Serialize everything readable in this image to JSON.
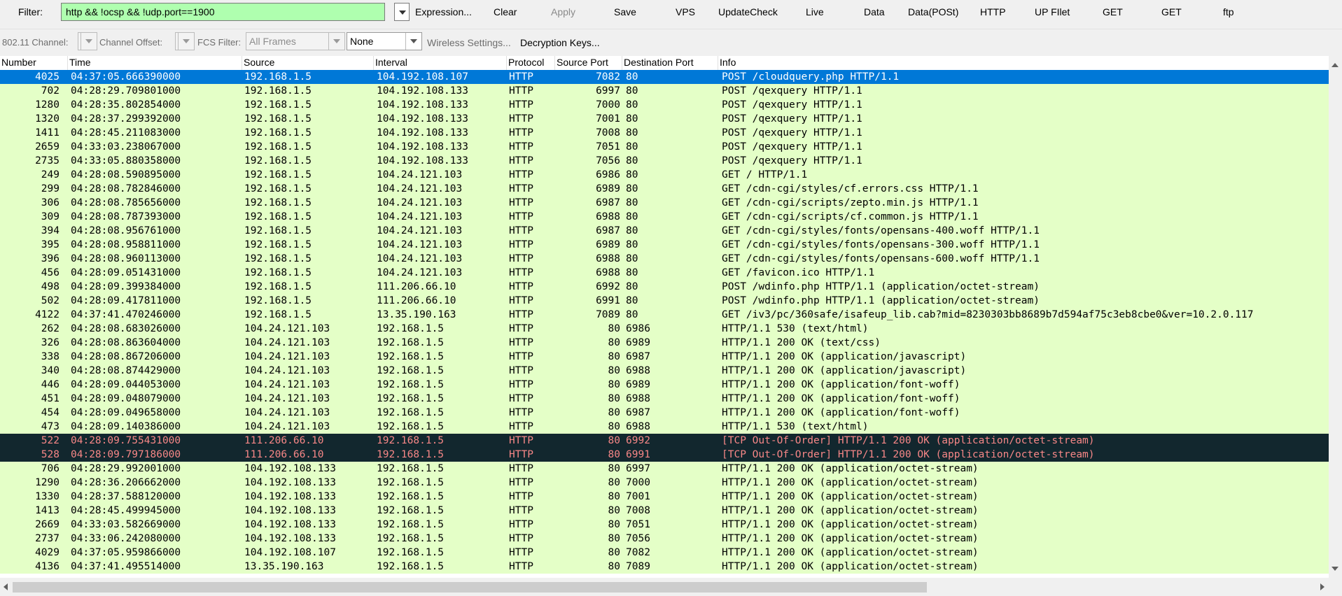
{
  "toolbar": {
    "filter_label": "Filter:",
    "filter_value": "http && !ocsp && !udp.port==1900",
    "buttons": [
      {
        "label": "Expression...",
        "enabled": true
      },
      {
        "label": "Clear",
        "enabled": true
      },
      {
        "label": "Apply",
        "enabled": false
      },
      {
        "label": "Save",
        "enabled": true
      },
      {
        "label": "VPS",
        "enabled": true
      },
      {
        "label": "UpdateCheck",
        "enabled": true
      },
      {
        "label": "Live",
        "enabled": true
      },
      {
        "label": "Data",
        "enabled": true
      },
      {
        "label": "Data(POSt)",
        "enabled": true
      },
      {
        "label": "HTTP",
        "enabled": true
      },
      {
        "label": "UP FIlet",
        "enabled": true
      },
      {
        "label": "GET",
        "enabled": true
      },
      {
        "label": "GET",
        "enabled": true
      },
      {
        "label": "ftp",
        "enabled": true
      }
    ]
  },
  "wireless": {
    "channel_label": "802.11 Channel:",
    "channel_value": "",
    "offset_label": "Channel Offset:",
    "offset_value": "",
    "fcs_label": "FCS Filter:",
    "fcs_value": "All Frames",
    "decrypt_value": "None",
    "settings_label": "Wireless Settings...",
    "keys_label": "Decryption Keys..."
  },
  "columns": [
    "Number",
    "Time",
    "Source",
    "Interval",
    "Protocol",
    "Source Port",
    "Destination Port",
    "Info"
  ],
  "colors": {
    "http_row": "#e4ffc7",
    "selected_row": "#0078d7",
    "bad_row_bg": "#12272e",
    "bad_row_fg": "#f78787",
    "filter_ok": "#afffaf"
  },
  "packets": [
    {
      "num": "4025",
      "time": "04:37:05.666390000",
      "src": "192.168.1.5",
      "dst": "104.192.108.107",
      "proto": "HTTP",
      "sport": "7082",
      "dport": "80",
      "info": "POST /cloudquery.php HTTP/1.1",
      "style": "sel"
    },
    {
      "num": "702",
      "time": "04:28:29.709801000",
      "src": "192.168.1.5",
      "dst": "104.192.108.133",
      "proto": "HTTP",
      "sport": "6997",
      "dport": "80",
      "info": "POST /qexquery HTTP/1.1",
      "style": ""
    },
    {
      "num": "1280",
      "time": "04:28:35.802854000",
      "src": "192.168.1.5",
      "dst": "104.192.108.133",
      "proto": "HTTP",
      "sport": "7000",
      "dport": "80",
      "info": "POST /qexquery HTTP/1.1",
      "style": ""
    },
    {
      "num": "1320",
      "time": "04:28:37.299392000",
      "src": "192.168.1.5",
      "dst": "104.192.108.133",
      "proto": "HTTP",
      "sport": "7001",
      "dport": "80",
      "info": "POST /qexquery HTTP/1.1",
      "style": ""
    },
    {
      "num": "1411",
      "time": "04:28:45.211083000",
      "src": "192.168.1.5",
      "dst": "104.192.108.133",
      "proto": "HTTP",
      "sport": "7008",
      "dport": "80",
      "info": "POST /qexquery HTTP/1.1",
      "style": ""
    },
    {
      "num": "2659",
      "time": "04:33:03.238067000",
      "src": "192.168.1.5",
      "dst": "104.192.108.133",
      "proto": "HTTP",
      "sport": "7051",
      "dport": "80",
      "info": "POST /qexquery HTTP/1.1",
      "style": ""
    },
    {
      "num": "2735",
      "time": "04:33:05.880358000",
      "src": "192.168.1.5",
      "dst": "104.192.108.133",
      "proto": "HTTP",
      "sport": "7056",
      "dport": "80",
      "info": "POST /qexquery HTTP/1.1",
      "style": ""
    },
    {
      "num": "249",
      "time": "04:28:08.590895000",
      "src": "192.168.1.5",
      "dst": "104.24.121.103",
      "proto": "HTTP",
      "sport": "6986",
      "dport": "80",
      "info": "GET / HTTP/1.1",
      "style": ""
    },
    {
      "num": "299",
      "time": "04:28:08.782846000",
      "src": "192.168.1.5",
      "dst": "104.24.121.103",
      "proto": "HTTP",
      "sport": "6989",
      "dport": "80",
      "info": "GET /cdn-cgi/styles/cf.errors.css HTTP/1.1",
      "style": ""
    },
    {
      "num": "306",
      "time": "04:28:08.785656000",
      "src": "192.168.1.5",
      "dst": "104.24.121.103",
      "proto": "HTTP",
      "sport": "6987",
      "dport": "80",
      "info": "GET /cdn-cgi/scripts/zepto.min.js HTTP/1.1",
      "style": ""
    },
    {
      "num": "309",
      "time": "04:28:08.787393000",
      "src": "192.168.1.5",
      "dst": "104.24.121.103",
      "proto": "HTTP",
      "sport": "6988",
      "dport": "80",
      "info": "GET /cdn-cgi/scripts/cf.common.js HTTP/1.1",
      "style": ""
    },
    {
      "num": "394",
      "time": "04:28:08.956761000",
      "src": "192.168.1.5",
      "dst": "104.24.121.103",
      "proto": "HTTP",
      "sport": "6987",
      "dport": "80",
      "info": "GET /cdn-cgi/styles/fonts/opensans-400.woff HTTP/1.1",
      "style": ""
    },
    {
      "num": "395",
      "time": "04:28:08.958811000",
      "src": "192.168.1.5",
      "dst": "104.24.121.103",
      "proto": "HTTP",
      "sport": "6989",
      "dport": "80",
      "info": "GET /cdn-cgi/styles/fonts/opensans-300.woff HTTP/1.1",
      "style": ""
    },
    {
      "num": "396",
      "time": "04:28:08.960113000",
      "src": "192.168.1.5",
      "dst": "104.24.121.103",
      "proto": "HTTP",
      "sport": "6988",
      "dport": "80",
      "info": "GET /cdn-cgi/styles/fonts/opensans-600.woff HTTP/1.1",
      "style": ""
    },
    {
      "num": "456",
      "time": "04:28:09.051431000",
      "src": "192.168.1.5",
      "dst": "104.24.121.103",
      "proto": "HTTP",
      "sport": "6988",
      "dport": "80",
      "info": "GET /favicon.ico HTTP/1.1",
      "style": ""
    },
    {
      "num": "498",
      "time": "04:28:09.399384000",
      "src": "192.168.1.5",
      "dst": "111.206.66.10",
      "proto": "HTTP",
      "sport": "6992",
      "dport": "80",
      "info": "POST /wdinfo.php HTTP/1.1  (application/octet-stream)",
      "style": ""
    },
    {
      "num": "502",
      "time": "04:28:09.417811000",
      "src": "192.168.1.5",
      "dst": "111.206.66.10",
      "proto": "HTTP",
      "sport": "6991",
      "dport": "80",
      "info": "POST /wdinfo.php HTTP/1.1  (application/octet-stream)",
      "style": ""
    },
    {
      "num": "4122",
      "time": "04:37:41.470246000",
      "src": "192.168.1.5",
      "dst": "13.35.190.163",
      "proto": "HTTP",
      "sport": "7089",
      "dport": "80",
      "info": "GET /iv3/pc/360safe/isafeup_lib.cab?mid=8230303bb8689b7d594af75c3eb8cbe0&ver=10.2.0.117",
      "style": ""
    },
    {
      "num": "262",
      "time": "04:28:08.683026000",
      "src": "104.24.121.103",
      "dst": "192.168.1.5",
      "proto": "HTTP",
      "sport": "80",
      "dport": "6986",
      "info": "HTTP/1.1 530   (text/html)",
      "style": ""
    },
    {
      "num": "326",
      "time": "04:28:08.863604000",
      "src": "104.24.121.103",
      "dst": "192.168.1.5",
      "proto": "HTTP",
      "sport": "80",
      "dport": "6989",
      "info": "HTTP/1.1 200 OK  (text/css)",
      "style": ""
    },
    {
      "num": "338",
      "time": "04:28:08.867206000",
      "src": "104.24.121.103",
      "dst": "192.168.1.5",
      "proto": "HTTP",
      "sport": "80",
      "dport": "6987",
      "info": "HTTP/1.1 200 OK  (application/javascript)",
      "style": ""
    },
    {
      "num": "340",
      "time": "04:28:08.874429000",
      "src": "104.24.121.103",
      "dst": "192.168.1.5",
      "proto": "HTTP",
      "sport": "80",
      "dport": "6988",
      "info": "HTTP/1.1 200 OK  (application/javascript)",
      "style": ""
    },
    {
      "num": "446",
      "time": "04:28:09.044053000",
      "src": "104.24.121.103",
      "dst": "192.168.1.5",
      "proto": "HTTP",
      "sport": "80",
      "dport": "6989",
      "info": "HTTP/1.1 200 OK  (application/font-woff)",
      "style": ""
    },
    {
      "num": "451",
      "time": "04:28:09.048079000",
      "src": "104.24.121.103",
      "dst": "192.168.1.5",
      "proto": "HTTP",
      "sport": "80",
      "dport": "6988",
      "info": "HTTP/1.1 200 OK  (application/font-woff)",
      "style": ""
    },
    {
      "num": "454",
      "time": "04:28:09.049658000",
      "src": "104.24.121.103",
      "dst": "192.168.1.5",
      "proto": "HTTP",
      "sport": "80",
      "dport": "6987",
      "info": "HTTP/1.1 200 OK  (application/font-woff)",
      "style": ""
    },
    {
      "num": "473",
      "time": "04:28:09.140386000",
      "src": "104.24.121.103",
      "dst": "192.168.1.5",
      "proto": "HTTP",
      "sport": "80",
      "dport": "6988",
      "info": "HTTP/1.1 530   (text/html)",
      "style": ""
    },
    {
      "num": "522",
      "time": "04:28:09.755431000",
      "src": "111.206.66.10",
      "dst": "192.168.1.5",
      "proto": "HTTP",
      "sport": "80",
      "dport": "6992",
      "info": "[TCP Out-Of-Order] HTTP/1.1 200 OK  (application/octet-stream)",
      "style": "bad"
    },
    {
      "num": "528",
      "time": "04:28:09.797186000",
      "src": "111.206.66.10",
      "dst": "192.168.1.5",
      "proto": "HTTP",
      "sport": "80",
      "dport": "6991",
      "info": "[TCP Out-Of-Order] HTTP/1.1 200 OK  (application/octet-stream)",
      "style": "bad"
    },
    {
      "num": "706",
      "time": "04:28:29.992001000",
      "src": "104.192.108.133",
      "dst": "192.168.1.5",
      "proto": "HTTP",
      "sport": "80",
      "dport": "6997",
      "info": "HTTP/1.1 200 OK  (application/octet-stream)",
      "style": ""
    },
    {
      "num": "1290",
      "time": "04:28:36.206662000",
      "src": "104.192.108.133",
      "dst": "192.168.1.5",
      "proto": "HTTP",
      "sport": "80",
      "dport": "7000",
      "info": "HTTP/1.1 200 OK  (application/octet-stream)",
      "style": ""
    },
    {
      "num": "1330",
      "time": "04:28:37.588120000",
      "src": "104.192.108.133",
      "dst": "192.168.1.5",
      "proto": "HTTP",
      "sport": "80",
      "dport": "7001",
      "info": "HTTP/1.1 200 OK  (application/octet-stream)",
      "style": ""
    },
    {
      "num": "1413",
      "time": "04:28:45.499945000",
      "src": "104.192.108.133",
      "dst": "192.168.1.5",
      "proto": "HTTP",
      "sport": "80",
      "dport": "7008",
      "info": "HTTP/1.1 200 OK  (application/octet-stream)",
      "style": ""
    },
    {
      "num": "2669",
      "time": "04:33:03.582669000",
      "src": "104.192.108.133",
      "dst": "192.168.1.5",
      "proto": "HTTP",
      "sport": "80",
      "dport": "7051",
      "info": "HTTP/1.1 200 OK  (application/octet-stream)",
      "style": ""
    },
    {
      "num": "2737",
      "time": "04:33:06.242080000",
      "src": "104.192.108.133",
      "dst": "192.168.1.5",
      "proto": "HTTP",
      "sport": "80",
      "dport": "7056",
      "info": "HTTP/1.1 200 OK  (application/octet-stream)",
      "style": ""
    },
    {
      "num": "4029",
      "time": "04:37:05.959866000",
      "src": "104.192.108.107",
      "dst": "192.168.1.5",
      "proto": "HTTP",
      "sport": "80",
      "dport": "7082",
      "info": "HTTP/1.1 200 OK  (application/octet-stream)",
      "style": ""
    },
    {
      "num": "4136",
      "time": "04:37:41.495514000",
      "src": "13.35.190.163",
      "dst": "192.168.1.5",
      "proto": "HTTP",
      "sport": "80",
      "dport": "7089",
      "info": "HTTP/1.1 200 OK  (application/octet-stream)",
      "style": ""
    }
  ]
}
